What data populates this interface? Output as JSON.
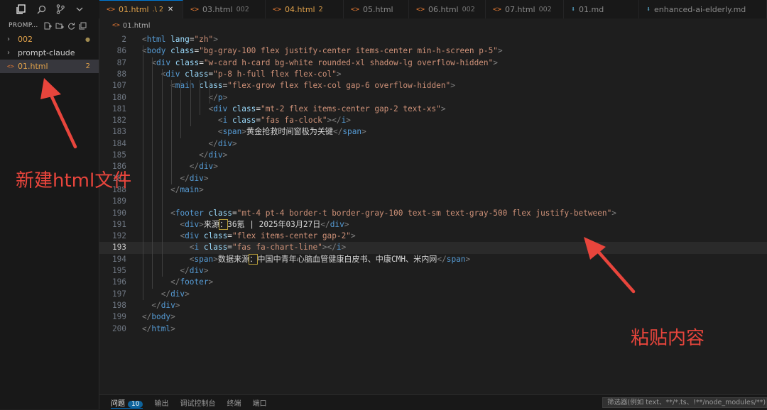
{
  "explorer": {
    "header": "PROMP...",
    "items": [
      {
        "label": "002",
        "kind": "folder",
        "color": "#e0a14a",
        "marker": "●"
      },
      {
        "label": "prompt-claude",
        "kind": "folder",
        "color": "#cccccc",
        "marker": ""
      },
      {
        "label": "01.html",
        "kind": "file",
        "color": "#e0a14a",
        "marker": "2"
      }
    ]
  },
  "tabs": [
    {
      "label": "01.html",
      "suffix": ".\\ 2",
      "active": true,
      "md": false
    },
    {
      "label": "03.html",
      "suffix": "002",
      "active": false,
      "md": false
    },
    {
      "label": "04.html",
      "suffix": "2",
      "active": false,
      "md": false
    },
    {
      "label": "05.html",
      "suffix": "",
      "active": false,
      "md": false
    },
    {
      "label": "06.html",
      "suffix": "002",
      "active": false,
      "md": false
    },
    {
      "label": "07.html",
      "suffix": "002",
      "active": false,
      "md": false
    },
    {
      "label": "01.md",
      "suffix": "",
      "active": false,
      "md": true
    },
    {
      "label": "enhanced-ai-elderly.md",
      "suffix": "",
      "active": false,
      "md": true
    }
  ],
  "breadcrumb": "01.html",
  "code_lines": [
    {
      "n": "2",
      "indent": 0,
      "parts": [
        [
          "t",
          "<"
        ],
        [
          "tn",
          "html"
        ],
        [
          "tx",
          " "
        ],
        [
          "at",
          "lang"
        ],
        [
          "tx",
          "="
        ],
        [
          "st",
          "\"zh\""
        ],
        [
          "t",
          ">"
        ]
      ]
    },
    {
      "n": "86",
      "indent": 0,
      "parts": [
        [
          "t",
          "<"
        ],
        [
          "tn",
          "body"
        ],
        [
          "tx",
          " "
        ],
        [
          "at",
          "class"
        ],
        [
          "tx",
          "="
        ],
        [
          "st",
          "\"bg-gray-100 flex justify-center items-center min-h-screen p-5\""
        ],
        [
          "t",
          ">"
        ]
      ]
    },
    {
      "n": "87",
      "indent": 1,
      "parts": [
        [
          "t",
          "<"
        ],
        [
          "tn",
          "div"
        ],
        [
          "tx",
          " "
        ],
        [
          "at",
          "class"
        ],
        [
          "tx",
          "="
        ],
        [
          "st",
          "\"w-card h-card bg-white rounded-xl shadow-lg overflow-hidden\""
        ],
        [
          "t",
          ">"
        ]
      ]
    },
    {
      "n": "88",
      "indent": 2,
      "parts": [
        [
          "t",
          "<"
        ],
        [
          "tn",
          "div"
        ],
        [
          "tx",
          " "
        ],
        [
          "at",
          "class"
        ],
        [
          "tx",
          "="
        ],
        [
          "st",
          "\"p-8 h-full flex flex-col\""
        ],
        [
          "t",
          ">"
        ]
      ]
    },
    {
      "n": "107",
      "indent": 3,
      "parts": [
        [
          "t",
          "<"
        ],
        [
          "tn",
          "main"
        ],
        [
          "tx",
          " "
        ],
        [
          "at",
          "class"
        ],
        [
          "tx",
          "="
        ],
        [
          "st",
          "\"flex-grow flex flex-col gap-6 overflow-hidden\""
        ],
        [
          "t",
          ">"
        ]
      ]
    },
    {
      "n": "180",
      "indent": 7,
      "parts": [
        [
          "t",
          "</"
        ],
        [
          "tn",
          "p"
        ],
        [
          "t",
          ">"
        ]
      ]
    },
    {
      "n": "181",
      "indent": 7,
      "parts": [
        [
          "t",
          "<"
        ],
        [
          "tn",
          "div"
        ],
        [
          "tx",
          " "
        ],
        [
          "at",
          "class"
        ],
        [
          "tx",
          "="
        ],
        [
          "st",
          "\"mt-2 flex items-center gap-2 text-xs\""
        ],
        [
          "t",
          ">"
        ]
      ]
    },
    {
      "n": "182",
      "indent": 8,
      "parts": [
        [
          "t",
          "<"
        ],
        [
          "tn",
          "i"
        ],
        [
          "tx",
          " "
        ],
        [
          "at",
          "class"
        ],
        [
          "tx",
          "="
        ],
        [
          "st",
          "\"fas fa-clock\""
        ],
        [
          "t",
          "></"
        ],
        [
          "tn",
          "i"
        ],
        [
          "t",
          ">"
        ]
      ]
    },
    {
      "n": "183",
      "indent": 8,
      "parts": [
        [
          "t",
          "<"
        ],
        [
          "tn",
          "span"
        ],
        [
          "t",
          ">"
        ],
        [
          "tx",
          "黄金抢救时间窗极为关键"
        ],
        [
          "t",
          "</"
        ],
        [
          "tn",
          "span"
        ],
        [
          "t",
          ">"
        ]
      ]
    },
    {
      "n": "184",
      "indent": 7,
      "parts": [
        [
          "t",
          "</"
        ],
        [
          "tn",
          "div"
        ],
        [
          "t",
          ">"
        ]
      ]
    },
    {
      "n": "185",
      "indent": 6,
      "parts": [
        [
          "t",
          "</"
        ],
        [
          "tn",
          "div"
        ],
        [
          "t",
          ">"
        ]
      ]
    },
    {
      "n": "186",
      "indent": 5,
      "parts": [
        [
          "t",
          "</"
        ],
        [
          "tn",
          "div"
        ],
        [
          "t",
          ">"
        ]
      ]
    },
    {
      "n": "187",
      "indent": 4,
      "parts": [
        [
          "t",
          "</"
        ],
        [
          "tn",
          "div"
        ],
        [
          "t",
          ">"
        ]
      ]
    },
    {
      "n": "188",
      "indent": 3,
      "parts": [
        [
          "t",
          "</"
        ],
        [
          "tn",
          "main"
        ],
        [
          "t",
          ">"
        ]
      ]
    },
    {
      "n": "189",
      "indent": 0,
      "parts": []
    },
    {
      "n": "190",
      "indent": 3,
      "parts": [
        [
          "t",
          "<"
        ],
        [
          "tn",
          "footer"
        ],
        [
          "tx",
          " "
        ],
        [
          "at",
          "class"
        ],
        [
          "tx",
          "="
        ],
        [
          "st",
          "\"mt-4 pt-4 border-t border-gray-100 text-sm text-gray-500 flex justify-between\""
        ],
        [
          "t",
          ">"
        ]
      ]
    },
    {
      "n": "191",
      "indent": 4,
      "parts": [
        [
          "t",
          "<"
        ],
        [
          "tn",
          "div"
        ],
        [
          "t",
          ">"
        ],
        [
          "tx",
          "来源"
        ],
        [
          "hl",
          "："
        ],
        [
          "tx",
          "36氪 | 2025年03月27日"
        ],
        [
          "t",
          "</"
        ],
        [
          "tn",
          "div"
        ],
        [
          "t",
          ">"
        ]
      ]
    },
    {
      "n": "192",
      "indent": 4,
      "parts": [
        [
          "t",
          "<"
        ],
        [
          "tn",
          "div"
        ],
        [
          "tx",
          " "
        ],
        [
          "at",
          "class"
        ],
        [
          "tx",
          "="
        ],
        [
          "st",
          "\"flex items-center gap-2\""
        ],
        [
          "t",
          ">"
        ]
      ]
    },
    {
      "n": "193",
      "indent": 5,
      "parts": [
        [
          "t",
          "<"
        ],
        [
          "tn",
          "i"
        ],
        [
          "tx",
          " "
        ],
        [
          "at",
          "class"
        ],
        [
          "tx",
          "="
        ],
        [
          "st",
          "\"fas fa-chart-line\""
        ],
        [
          "t",
          "></"
        ],
        [
          "tn",
          "i"
        ],
        [
          "t",
          ">"
        ]
      ]
    },
    {
      "n": "194",
      "indent": 5,
      "parts": [
        [
          "t",
          "<"
        ],
        [
          "tn",
          "span"
        ],
        [
          "t",
          ">"
        ],
        [
          "tx",
          "数据来源"
        ],
        [
          "hl",
          "："
        ],
        [
          "tx",
          "中国中青年心脑血管健康白皮书、中康CMH、米内网"
        ],
        [
          "t",
          "</"
        ],
        [
          "tn",
          "span"
        ],
        [
          "t",
          ">"
        ]
      ]
    },
    {
      "n": "195",
      "indent": 4,
      "parts": [
        [
          "t",
          "</"
        ],
        [
          "tn",
          "div"
        ],
        [
          "t",
          ">"
        ]
      ]
    },
    {
      "n": "196",
      "indent": 3,
      "parts": [
        [
          "t",
          "</"
        ],
        [
          "tn",
          "footer"
        ],
        [
          "t",
          ">"
        ]
      ]
    },
    {
      "n": "197",
      "indent": 2,
      "parts": [
        [
          "t",
          "</"
        ],
        [
          "tn",
          "div"
        ],
        [
          "t",
          ">"
        ]
      ]
    },
    {
      "n": "198",
      "indent": 1,
      "parts": [
        [
          "t",
          "</"
        ],
        [
          "tn",
          "div"
        ],
        [
          "t",
          ">"
        ]
      ]
    },
    {
      "n": "199",
      "indent": 0,
      "parts": [
        [
          "t",
          "</"
        ],
        [
          "tn",
          "body"
        ],
        [
          "t",
          ">"
        ]
      ]
    },
    {
      "n": "200",
      "indent": 0,
      "parts": [
        [
          "t",
          "</"
        ],
        [
          "tn",
          "html"
        ],
        [
          "t",
          ">"
        ]
      ]
    }
  ],
  "current_line": "193",
  "panel": {
    "tabs": [
      {
        "label": "问题",
        "active": true,
        "badge": "10"
      },
      {
        "label": "输出",
        "active": false,
        "badge": ""
      },
      {
        "label": "调试控制台",
        "active": false,
        "badge": ""
      },
      {
        "label": "终端",
        "active": false,
        "badge": ""
      },
      {
        "label": "端口",
        "active": false,
        "badge": ""
      }
    ],
    "filter_placeholder": "筛选器(例如 text、**/*.ts、!**/node_modules/**)"
  },
  "annotations": {
    "left": "新建html文件",
    "right": "粘贴内容",
    "color": "#e8453c"
  }
}
